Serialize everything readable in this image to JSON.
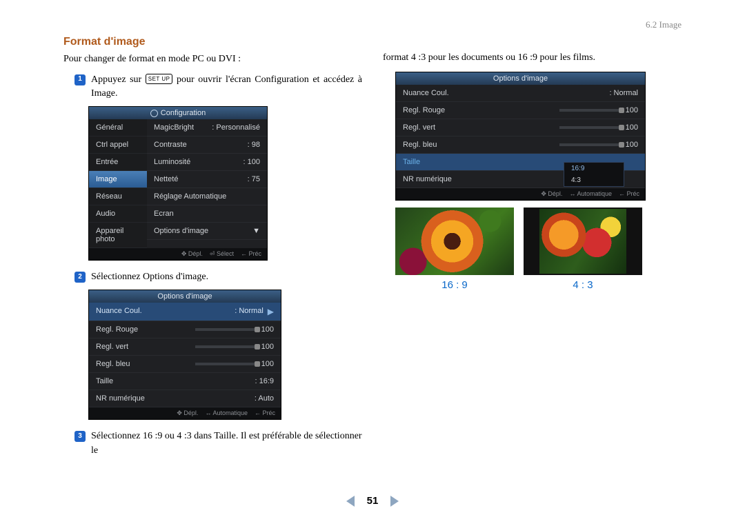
{
  "header": {
    "breadcrumb": "6.2 Image"
  },
  "section_title": "Format d'image",
  "intro": "Pour changer de format en mode PC ou DVI :",
  "steps": {
    "s1_a": "Appuyez sur ",
    "s1_key": "SET UP",
    "s1_b": " pour ouvrir l'écran Configuration et accédez à Image.",
    "s2": "Sélectionnez Options d'image.",
    "s3": "Sélectionnez 16 :9 ou 4 :3 dans Taille. Il est préférable de sélectionner le",
    "s3_cont": "format 4 :3 pour les documents ou 16 :9 pour les films."
  },
  "osd_config": {
    "title": "Configuration",
    "side": [
      "Général",
      "Ctrl appel",
      "Entrée",
      "Image",
      "Réseau",
      "Audio",
      "Appareil photo"
    ],
    "side_selected": "Image",
    "rows": [
      {
        "l": "MagicBright",
        "v": ": Personnalisé"
      },
      {
        "l": "Contraste",
        "v": ": 98"
      },
      {
        "l": "Luminosité",
        "v": ": 100"
      },
      {
        "l": "Netteté",
        "v": ": 75"
      },
      {
        "l": "Réglage Automatique",
        "v": ""
      },
      {
        "l": "Ecran",
        "v": ""
      },
      {
        "l": "Options d'image",
        "v": ""
      }
    ],
    "foot": [
      "✥ Dépl.",
      "⏎ Sélect",
      "← Préc"
    ]
  },
  "osd_options": {
    "title": "Options d'image",
    "rows": [
      {
        "l": "Nuance Coul.",
        "v": ": Normal",
        "sel": true,
        "arrow": true
      },
      {
        "l": "Regl. Rouge",
        "v": "100",
        "slider": true
      },
      {
        "l": "Regl. vert",
        "v": "100",
        "slider": true
      },
      {
        "l": "Regl. bleu",
        "v": "100",
        "slider": true
      },
      {
        "l": "Taille",
        "v": ": 16:9"
      },
      {
        "l": "NR numérique",
        "v": ": Auto"
      }
    ],
    "foot": [
      "✥ Dépl.",
      "↔ Automatique",
      "← Préc"
    ]
  },
  "osd_options_right": {
    "title": "Options d'image",
    "rows": [
      {
        "l": "Nuance Coul.",
        "v": ": Normal"
      },
      {
        "l": "Regl. Rouge",
        "v": "100",
        "slider": true
      },
      {
        "l": "Regl. vert",
        "v": "100",
        "slider": true
      },
      {
        "l": "Regl. bleu",
        "v": "100",
        "slider": true
      },
      {
        "l": "Taille",
        "v": "",
        "sel": true,
        "popup": true
      },
      {
        "l": "NR numérique",
        "v": ""
      }
    ],
    "popup": [
      "16:9",
      "4:3"
    ],
    "popup_selected": "16:9",
    "foot": [
      "✥ Dépl.",
      "↔ Automatique",
      "← Préc"
    ]
  },
  "ratios": {
    "r169": "16 : 9",
    "r43": "4 : 3"
  },
  "footer_page": "51"
}
